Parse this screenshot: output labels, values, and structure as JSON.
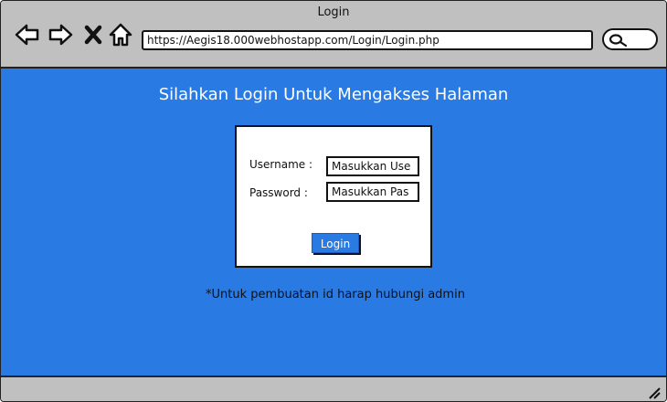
{
  "window": {
    "title": "Login"
  },
  "toolbar": {
    "url": "https://Aegis18.000webhostapp.com/Login/Login.php",
    "icons": [
      "back-arrow-icon",
      "forward-arrow-icon",
      "close-x-icon",
      "home-icon",
      "search-icon"
    ]
  },
  "page": {
    "title": "Silahkan Login Untuk Mengakses Halaman",
    "note": "*Untuk pembuatan id harap hubungi admin"
  },
  "login_form": {
    "username_label": "Username :",
    "username_value": "Masukkan Use",
    "password_label": "Password  :",
    "password_value": "Masukkan Pas",
    "submit_label": "Login"
  },
  "colors": {
    "content_bg": "#2a7ae4",
    "chrome_bg": "#c0c0c0",
    "button_bg": "#2a7ae4"
  }
}
